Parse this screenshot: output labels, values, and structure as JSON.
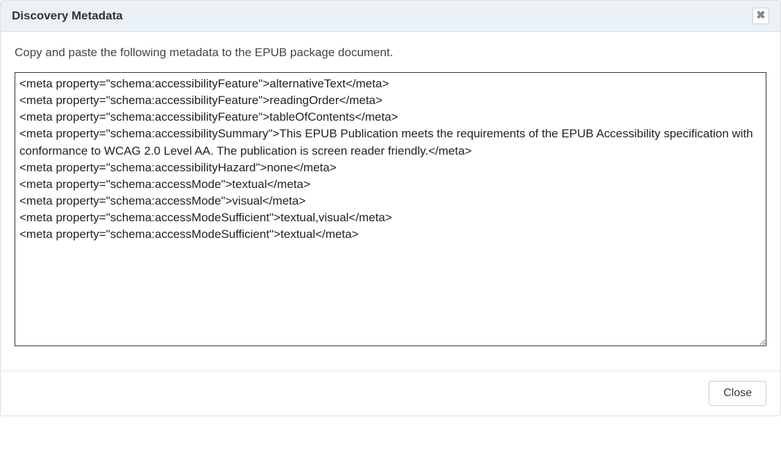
{
  "dialog": {
    "title": "Discovery Metadata",
    "instruction": "Copy and paste the following metadata to the EPUB package document.",
    "metadata_text": "<meta property=\"schema:accessibilityFeature\">alternativeText</meta>\n<meta property=\"schema:accessibilityFeature\">readingOrder</meta>\n<meta property=\"schema:accessibilityFeature\">tableOfContents</meta>\n<meta property=\"schema:accessibilitySummary\">This EPUB Publication meets the requirements of the EPUB Accessibility specification with conformance to WCAG 2.0 Level AA. The publication is screen reader friendly.</meta>\n<meta property=\"schema:accessibilityHazard\">none</meta>\n<meta property=\"schema:accessMode\">textual</meta>\n<meta property=\"schema:accessMode\">visual</meta>\n<meta property=\"schema:accessModeSufficient\">textual,visual</meta>\n<meta property=\"schema:accessModeSufficient\">textual</meta>",
    "close_button_label": "Close",
    "close_x_label": "✖"
  }
}
